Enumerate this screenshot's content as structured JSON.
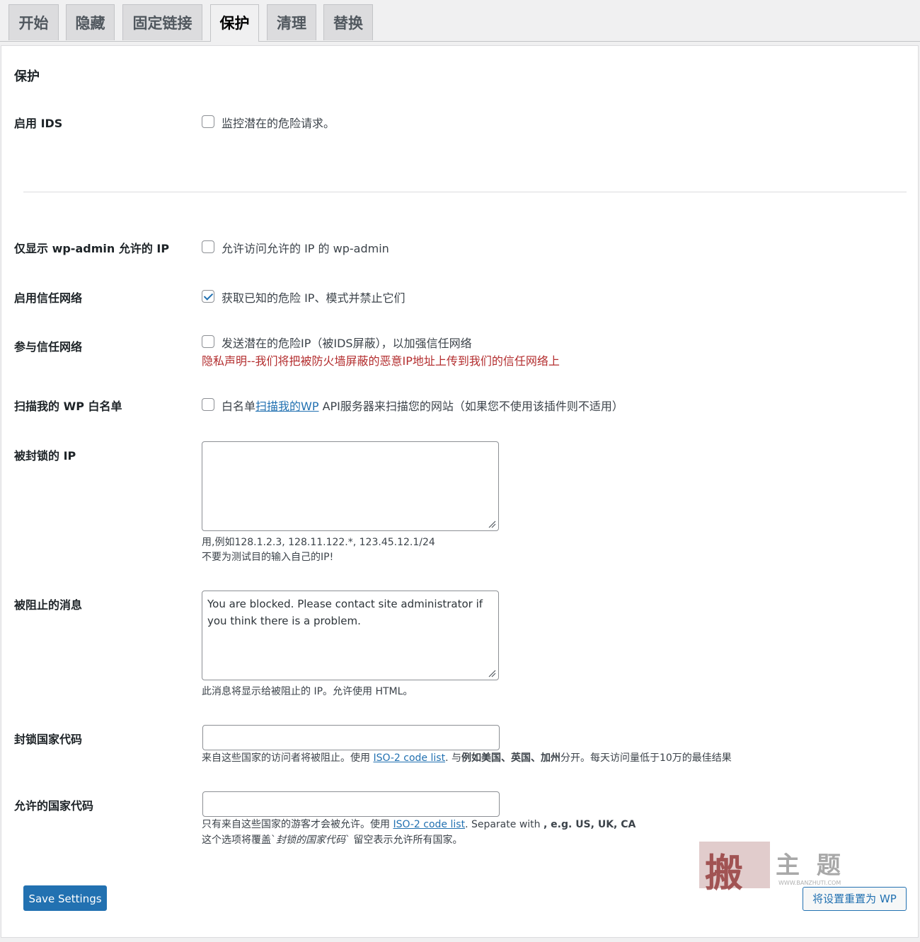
{
  "tabs": [
    "开始",
    "隐藏",
    "固定链接",
    "保护",
    "清理",
    "替换"
  ],
  "section_title": "保护",
  "rows": {
    "ids": {
      "label": "启用 IDS",
      "option": "监控潜在的危险请求。",
      "checked": false
    },
    "wpadmin": {
      "label": "仅显示 wp-admin 允许的 IP",
      "option": "允许访问允许的 IP 的 wp-admin",
      "checked": false
    },
    "trust_enable": {
      "label": "启用信任网络",
      "option": "获取已知的危险 IP、模式并禁止它们",
      "checked": true
    },
    "trust_join": {
      "label": "参与信任网络",
      "option": "发送潜在的危险IP（被IDS屏蔽），以加强信任网络",
      "privacy": "隐私声明--我们将把被防火墙屏蔽的恶意IP地址上传到我们的信任网络上",
      "checked": false
    },
    "scan": {
      "label": "扫描我的 WP 白名单",
      "option_pre": "白名单",
      "option_link": "扫描我的WP",
      "option_post": " API服务器来扫描您的网站（如果您不使用该插件则不适用）",
      "checked": false
    },
    "blocked_ips": {
      "label": "被封锁的 IP",
      "value": "",
      "desc1": "用,例如128.1.2.3, 128.11.122.*, 123.45.12.1/24",
      "desc2": "不要为测试目的输入自己的IP!"
    },
    "blocked_msg": {
      "label": "被阻止的消息",
      "value": "You are blocked. Please contact site administrator if you think there is a problem.",
      "desc": "此消息将显示给被阻止的 IP。允许使用 HTML。"
    },
    "block_country": {
      "label": "封锁国家代码",
      "value": "",
      "desc_pre": "来自这些国家的访问者将被阻止。使用 ",
      "desc_link": "ISO-2 code list",
      "desc_mid": ". 与",
      "desc_bold": "例如美国、英国、加州",
      "desc_post": "分开。每天访问量低于10万的最佳结果"
    },
    "allow_country": {
      "label": "允许的国家代码",
      "value": "",
      "desc_pre": "只有来自这些国家的游客才会被允许。使用 ",
      "desc_link": "ISO-2 code list",
      "desc_mid": ". Separate with ",
      "desc_bold": ", e.g. US, UK, CA",
      "desc2_pre": "这个选项将覆盖`",
      "desc2_em": "封锁的国家代码",
      "desc2_post": "` 留空表示允许所有国家。"
    }
  },
  "buttons": {
    "save": "Save Settings",
    "reset": "将设置重置为 WP"
  },
  "watermark": {
    "char": "搬",
    "text": "主 题",
    "url": "WWW.BANZHUTI.COM"
  }
}
